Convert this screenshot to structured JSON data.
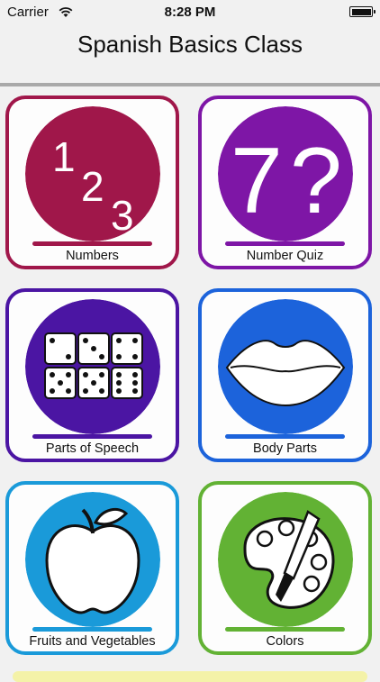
{
  "status_bar": {
    "carrier": "Carrier",
    "time": "8:28 PM"
  },
  "header": {
    "title": "Spanish Basics Class"
  },
  "tiles": [
    {
      "label": "Numbers",
      "color": "#a0174a",
      "icon": "numbers-icon"
    },
    {
      "label": "Number Quiz",
      "color": "#7e16a6",
      "icon": "number-quiz-icon"
    },
    {
      "label": "Parts of Speech",
      "color": "#4b15a3",
      "icon": "dice-icon"
    },
    {
      "label": "Body Parts",
      "color": "#1c63db",
      "icon": "lips-icon"
    },
    {
      "label": "Fruits and Vegetables",
      "color": "#1a9ad9",
      "icon": "apple-icon"
    },
    {
      "label": "Colors",
      "color": "#62b234",
      "icon": "palette-icon"
    }
  ],
  "icon_text": {
    "numbers": [
      "1",
      "2",
      "3"
    ],
    "quiz": [
      "7",
      "?"
    ]
  }
}
